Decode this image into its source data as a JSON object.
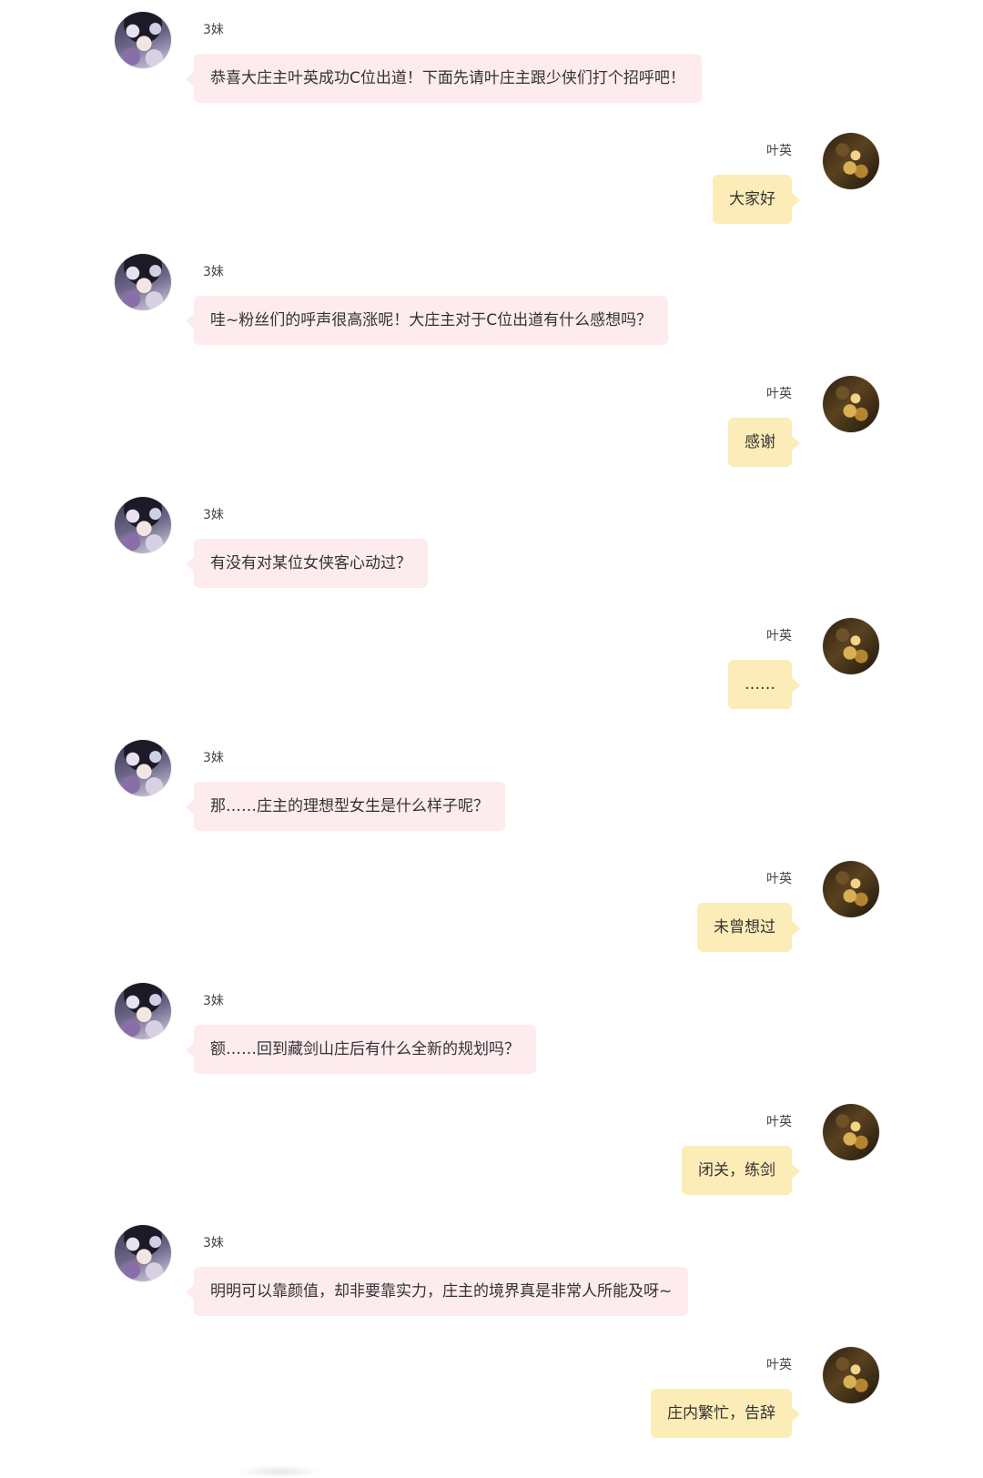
{
  "chat": {
    "messages": [
      {
        "side": "left",
        "name": "3妹",
        "text": "恭喜大庄主叶英成功C位出道！下面先请叶庄主跟少侠们打个招呼吧！"
      },
      {
        "side": "right",
        "name": "叶英",
        "text": "大家好"
      },
      {
        "side": "left",
        "name": "3妹",
        "text": "哇~粉丝们的呼声很高涨呢！大庄主对于C位出道有什么感想吗？"
      },
      {
        "side": "right",
        "name": "叶英",
        "text": "感谢"
      },
      {
        "side": "left",
        "name": "3妹",
        "text": "有没有对某位女侠客心动过？"
      },
      {
        "side": "right",
        "name": "叶英",
        "text": "……"
      },
      {
        "side": "left",
        "name": "3妹",
        "text": "那……庄主的理想型女生是什么样子呢？"
      },
      {
        "side": "right",
        "name": "叶英",
        "text": "未曾想过"
      },
      {
        "side": "left",
        "name": "3妹",
        "text": "额……回到藏剑山庄后有什么全新的规划吗？"
      },
      {
        "side": "right",
        "name": "叶英",
        "text": "闭关，练剑"
      },
      {
        "side": "left",
        "name": "3妹",
        "text": "明明可以靠颜值，却非要靠实力，庄主的境界真是非常人所能及呀~"
      },
      {
        "side": "right",
        "name": "叶英",
        "text": "庄内繁忙，告辞"
      }
    ]
  },
  "colors": {
    "left_bubble": "#fdebee",
    "right_bubble": "#fcecb7",
    "text": "#333333",
    "name_text": "#444444",
    "background": "#ffffff"
  },
  "icons": {
    "left_avatar": "avatar-3mei-icon",
    "right_avatar": "avatar-yeying-icon"
  }
}
